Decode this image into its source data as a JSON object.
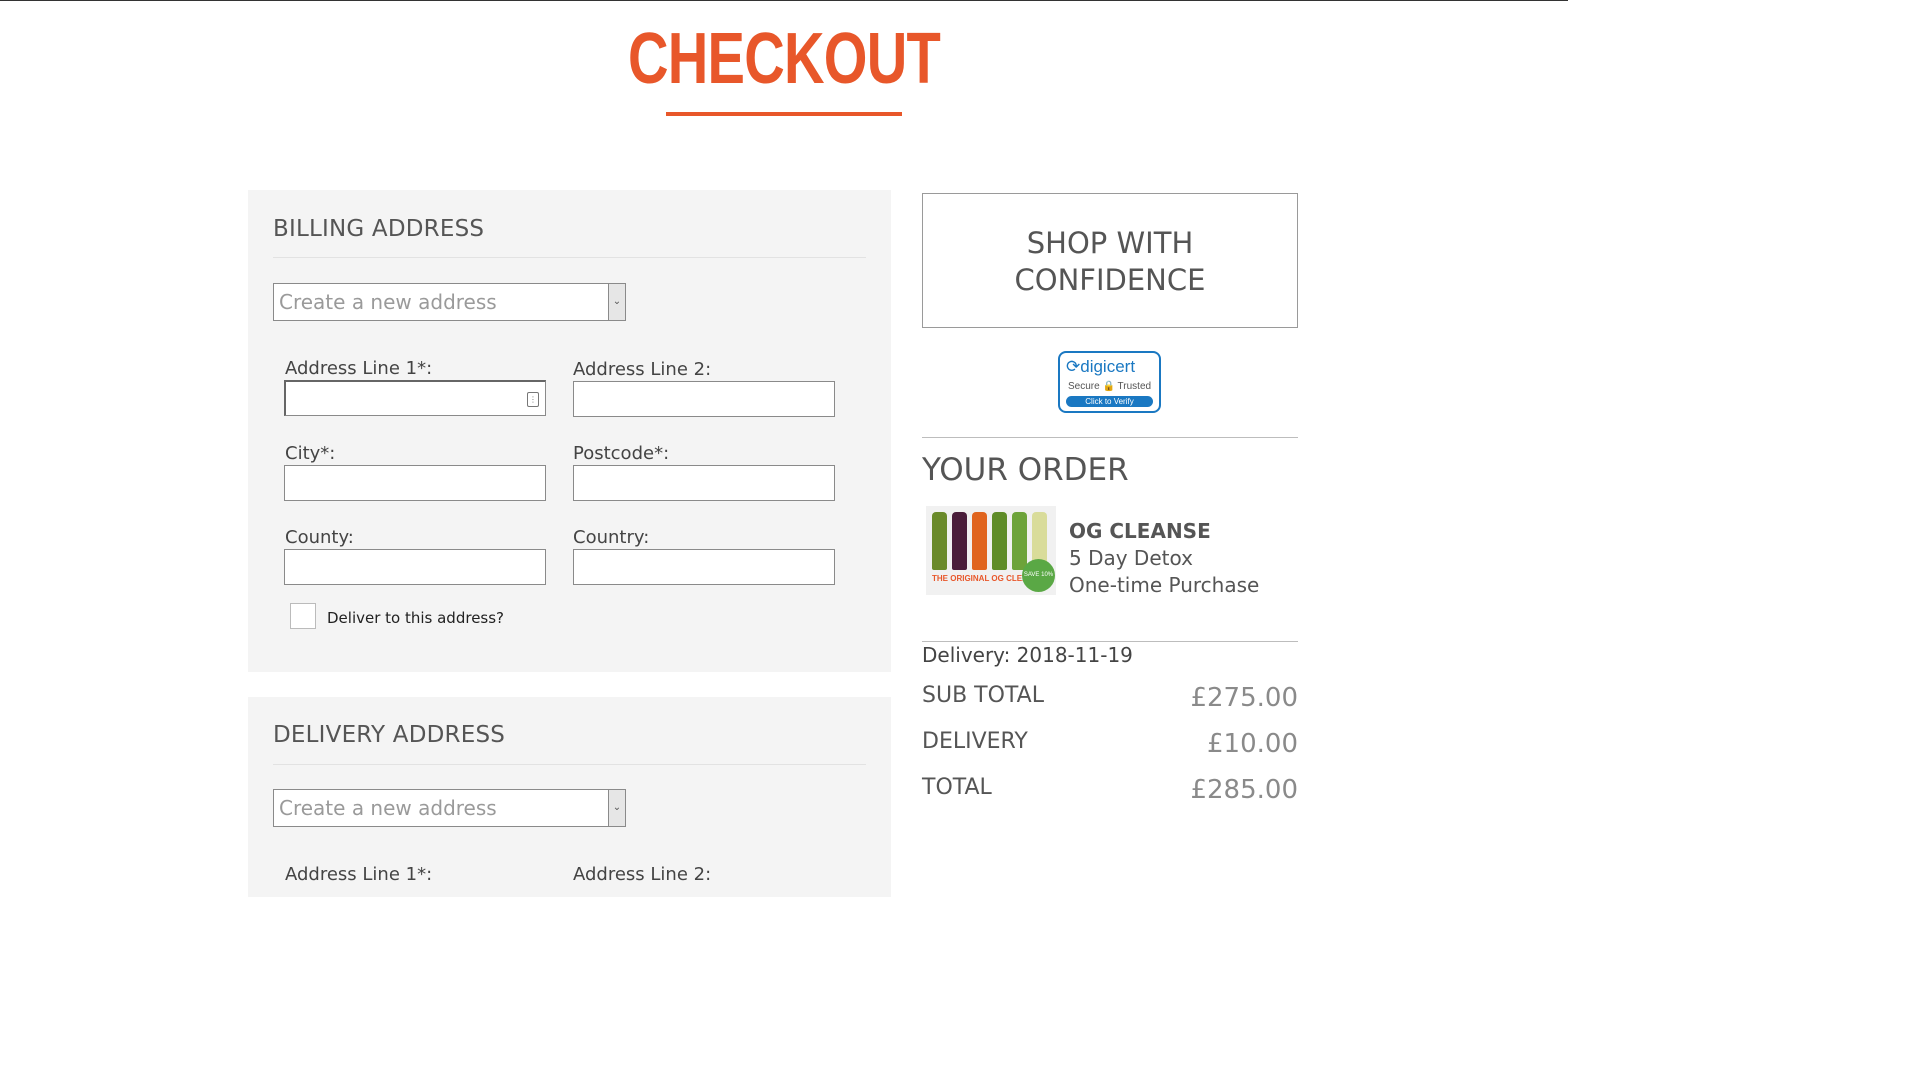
{
  "page": {
    "title": "CHECKOUT"
  },
  "billing": {
    "heading": "BILLING ADDRESS",
    "select_value": "Create a new address",
    "fields": {
      "address1": "Address Line 1*:",
      "address2": "Address Line 2:",
      "city": "City*:",
      "postcode": "Postcode*:",
      "county": "County:",
      "country": "Country:"
    },
    "deliver_checkbox_label": "Deliver to this address?"
  },
  "delivery": {
    "heading": "DELIVERY ADDRESS",
    "select_value": "Create a new address",
    "fields": {
      "address1": "Address Line 1*:",
      "address2": "Address Line 2:"
    }
  },
  "sidebar": {
    "confidence_line1": "SHOP WITH",
    "confidence_line2": "CONFIDENCE",
    "seal": {
      "brand": "digicert",
      "trust_secure": "Secure",
      "trust_trusted": "Trusted",
      "verify": "Click to Verify"
    },
    "order_heading": "YOUR ORDER",
    "product": {
      "image_caption": "THE ORIGINAL OG CLEANSE",
      "image_badge": "SAVE 10%",
      "name": "OG CLEANSE",
      "description": "5 Day Detox",
      "purchase_type": "One-time Purchase"
    },
    "delivery_date": "Delivery: 2018-11-19",
    "totals": {
      "subtotal_label": "SUB TOTAL",
      "subtotal_value": "£275.00",
      "delivery_label": "DELIVERY",
      "delivery_value": "£10.00",
      "total_label": "TOTAL",
      "total_value": "£285.00"
    }
  },
  "colors": {
    "accent": "#e8572a",
    "panel_bg": "#f4f4f4",
    "digicert_blue": "#1a78c2"
  },
  "icons": {
    "select_arrow": "chevron-down-icon",
    "autofill": "contact-card-icon",
    "seal_lock": "lock-icon"
  }
}
